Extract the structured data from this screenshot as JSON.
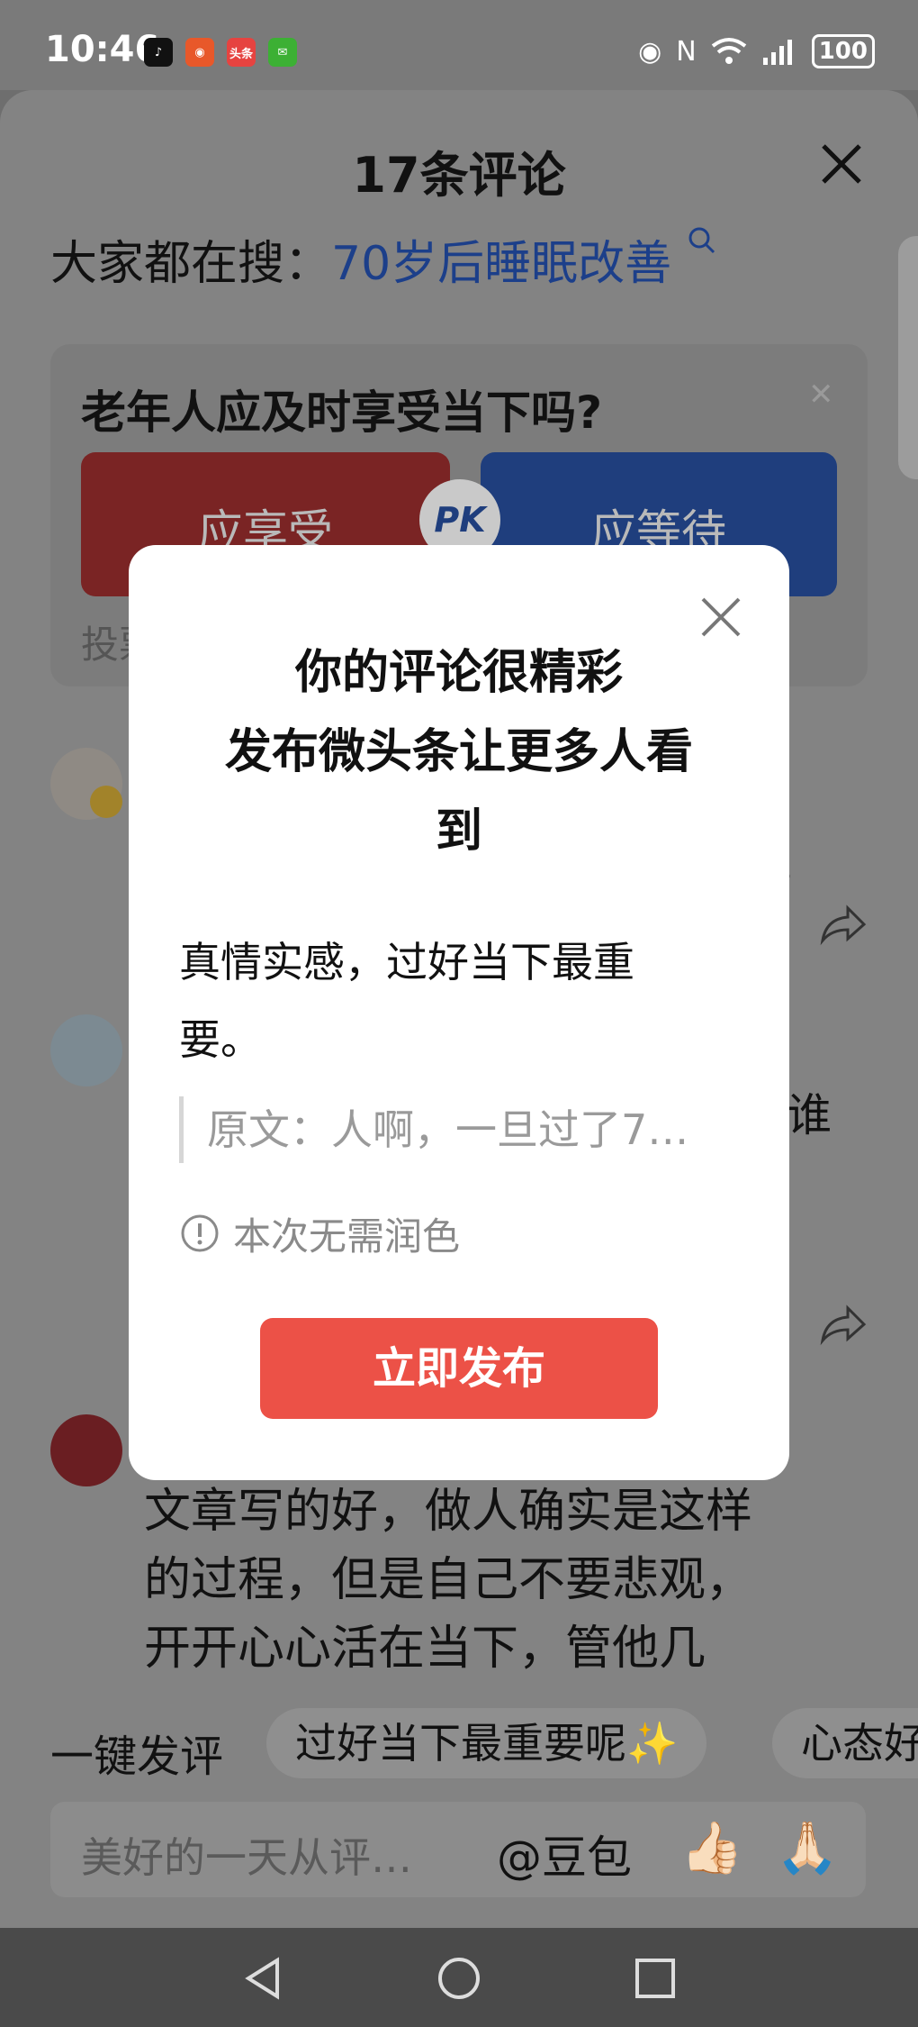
{
  "status_bar": {
    "time": "10:46",
    "battery": "100",
    "apps": [
      {
        "name": "tiktok-icon",
        "label": "♪",
        "color": "#111111"
      },
      {
        "name": "app-icon",
        "label": "◉",
        "color": "#e8582a"
      },
      {
        "name": "toutiao-icon",
        "label": "头条",
        "color": "#e64340"
      },
      {
        "name": "wechat-icon",
        "label": "✉",
        "color": "#3cb034"
      }
    ]
  },
  "sheet": {
    "title": "17条评论",
    "search_prefix": "大家都在搜：",
    "search_keyword": "70岁后睡眠改善"
  },
  "pk": {
    "question": "老年人应及时享受当下吗?",
    "left_option": "应享受",
    "right_option": "应等待",
    "badge": "PK",
    "vote_prefix": "投票",
    "close": "✕"
  },
  "background_comments": {
    "fragment_1": "。",
    "fragment_2": "谁",
    "comment_lines": [
      "文章写的好，做人确实是这样",
      "的过程，但是自己不要悲观，",
      "开开心心活在当下，管他几"
    ]
  },
  "quick_comment": {
    "label": "一键发评",
    "chips": [
      "过好当下最重要呢✨",
      "心态好"
    ]
  },
  "input": {
    "placeholder": "美好的一天从评…",
    "doubao": "@豆包",
    "emoji_1": "👍🏻",
    "emoji_2": "🙏🏻"
  },
  "modal": {
    "title_lines": [
      "你的评论很精彩",
      "发布微头条让更多人看",
      "到"
    ],
    "body_lines": [
      "真情实感，过好当下最重",
      "要。"
    ],
    "quote": "原文：人啊，一旦过了7…",
    "hint": "本次无需润色",
    "publish_label": "立即发布"
  },
  "colors": {
    "accent_red": "#ec5147",
    "pk_red": "#7a2424",
    "pk_blue": "#1f3e7d",
    "keyword_blue": "#1c3f8a"
  }
}
